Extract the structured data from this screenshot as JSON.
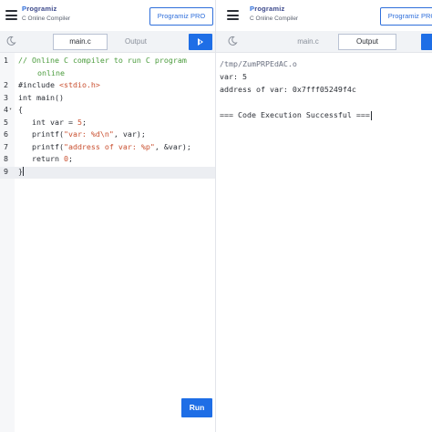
{
  "header": {
    "logo_text": "rogramiz",
    "subtitle": "C Online Compiler",
    "pro_button": "Programiz PRO"
  },
  "tabs": {
    "code": "main.c",
    "output": "Output"
  },
  "editor": {
    "lines": [
      {
        "num": "1",
        "comment": "// Online C compiler to run C program"
      },
      {
        "cont": "online"
      },
      {
        "num": "2",
        "pre": "#include ",
        "str": "<stdio.h>"
      },
      {
        "num": "3",
        "text": "int main()"
      },
      {
        "num": "4",
        "text": "{"
      },
      {
        "num": "5",
        "pre": "   int var = ",
        "num_lit": "5",
        "post": ";"
      },
      {
        "num": "6",
        "pre": "   printf(",
        "str": "\"var: %d\\n\"",
        "post": ", var);"
      },
      {
        "num": "7",
        "pre": "   printf(",
        "str": "\"address of var: %p\"",
        "post": ", &var);"
      },
      {
        "num": "8",
        "pre": "   return ",
        "num_lit": "0",
        "post": ";"
      },
      {
        "num": "9",
        "text": "}"
      }
    ]
  },
  "run_button": "Run",
  "output": {
    "lines": [
      "/tmp/ZumPRPEdAC.o",
      "var: 5",
      "address of var: 0x7fff05249f4c",
      "",
      "=== Code Execution Successful ==="
    ]
  },
  "colors": {
    "accent": "#1e6ee6",
    "comment": "#4a9b3c",
    "string": "#c94f2f"
  }
}
